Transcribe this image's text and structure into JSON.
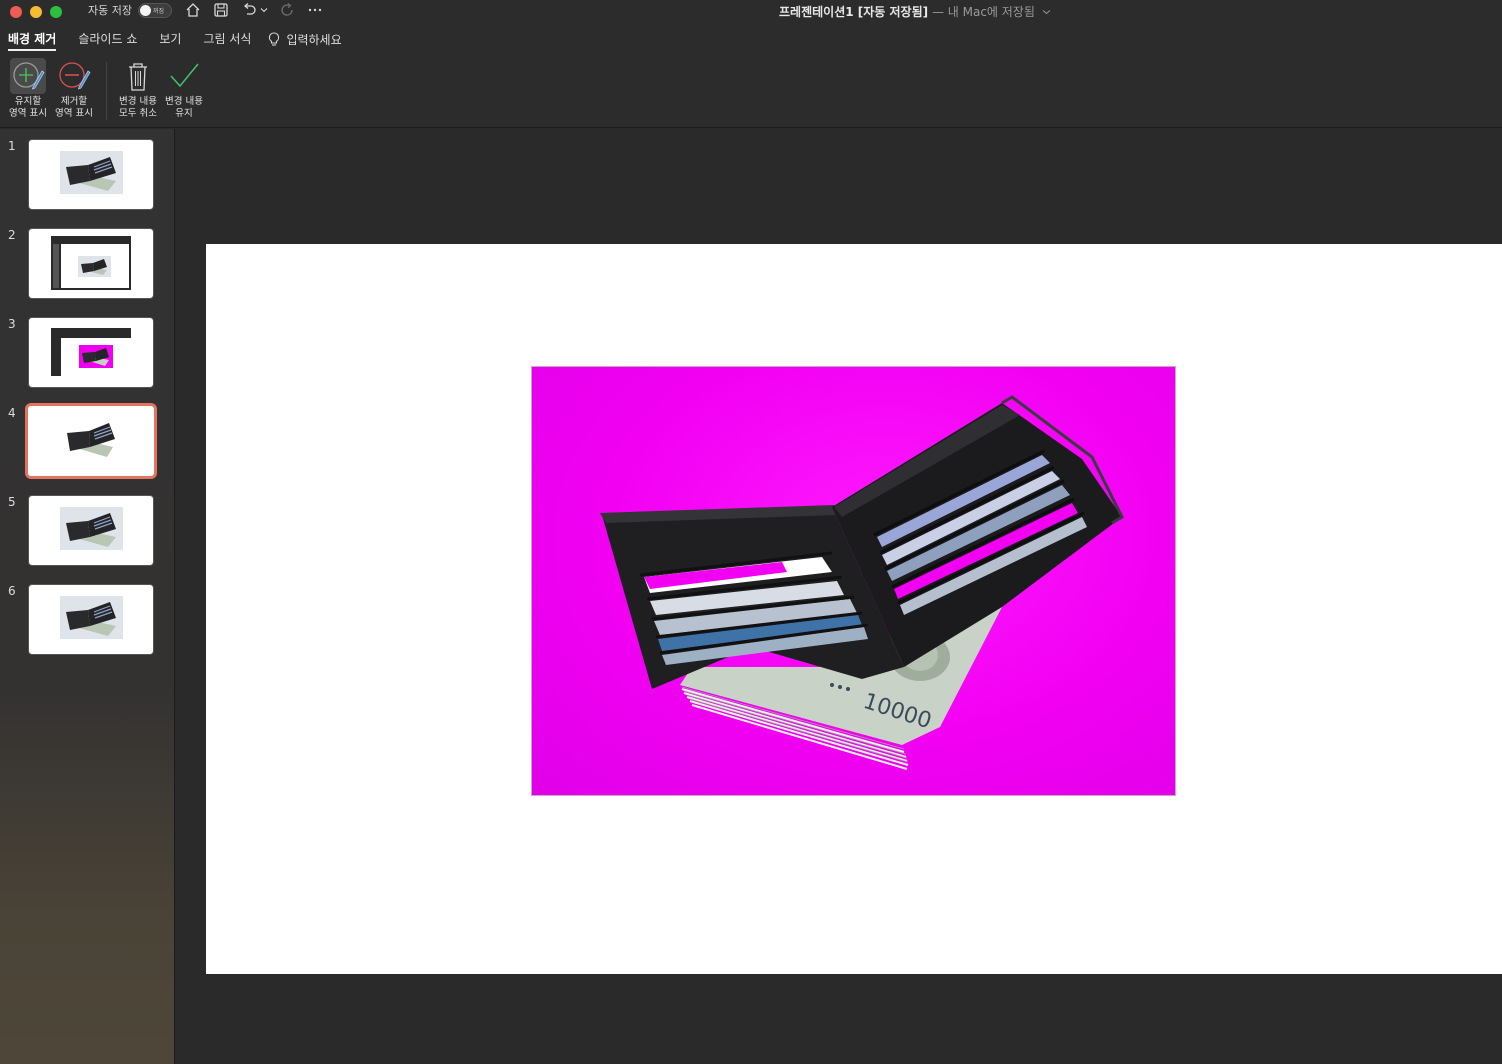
{
  "window": {
    "autosave_label": "자동 저장",
    "autosave_state": "꺼짐",
    "title": "프레젠테이션1 [자동 저장됨]",
    "location": " — 내 Mac에 저장됨"
  },
  "ribbon_tabs": [
    {
      "label": "배경 제거",
      "active": true
    },
    {
      "label": "슬라이드 쇼",
      "active": false
    },
    {
      "label": "보기",
      "active": false
    },
    {
      "label": "그림 서식",
      "active": false
    }
  ],
  "tell_me": "입력하세요",
  "ribbon_buttons": {
    "mark_keep": {
      "line1": "유지할",
      "line2": "영역 표시"
    },
    "mark_remove": {
      "line1": "제거할",
      "line2": "영역 표시"
    },
    "discard_all": {
      "line1": "변경 내용",
      "line2": "모두 취소"
    },
    "keep_changes": {
      "line1": "변경 내용",
      "line2": "유지"
    }
  },
  "slides": [
    {
      "number": "1",
      "kind": "photo",
      "selected": false
    },
    {
      "number": "2",
      "kind": "screenshot",
      "selected": false
    },
    {
      "number": "3",
      "kind": "screenshot-magenta",
      "selected": false
    },
    {
      "number": "4",
      "kind": "cutout",
      "selected": true
    },
    {
      "number": "5",
      "kind": "photo",
      "selected": false
    },
    {
      "number": "6",
      "kind": "photo",
      "selected": false
    }
  ],
  "banknote_text": "10000",
  "colors": {
    "removal_overlay": "#f200f2",
    "selection_border": "#e27461",
    "app_background": "#2a2a2a"
  }
}
